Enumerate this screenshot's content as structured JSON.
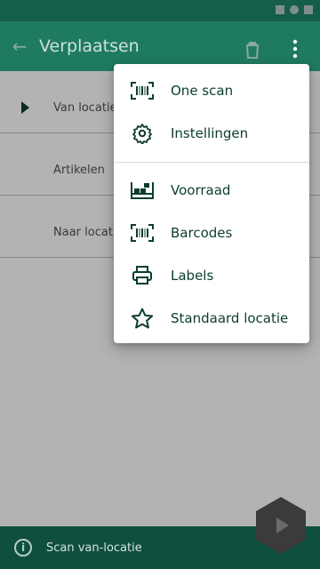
{
  "app": {
    "title": "Verplaatsen"
  },
  "list": {
    "rows": [
      {
        "label": "Van locatie"
      },
      {
        "label": "Artikelen"
      },
      {
        "label": "Naar locatie"
      }
    ]
  },
  "bottom": {
    "status": "Scan van-locatie"
  },
  "menu": {
    "items": [
      {
        "label": "One scan",
        "icon": "barcode-scan-icon"
      },
      {
        "label": "Instellingen",
        "icon": "gear-icon"
      },
      {
        "label": "Voorraad",
        "icon": "warehouse-shelf-icon"
      },
      {
        "label": "Barcodes",
        "icon": "barcode-scan-icon"
      },
      {
        "label": "Labels",
        "icon": "printer-icon"
      },
      {
        "label": "Standaard locatie",
        "icon": "star-icon"
      }
    ]
  },
  "colors": {
    "primary": "#1f7a62",
    "dark": "#0f4f3f",
    "menu_text": "#0b3d31"
  }
}
